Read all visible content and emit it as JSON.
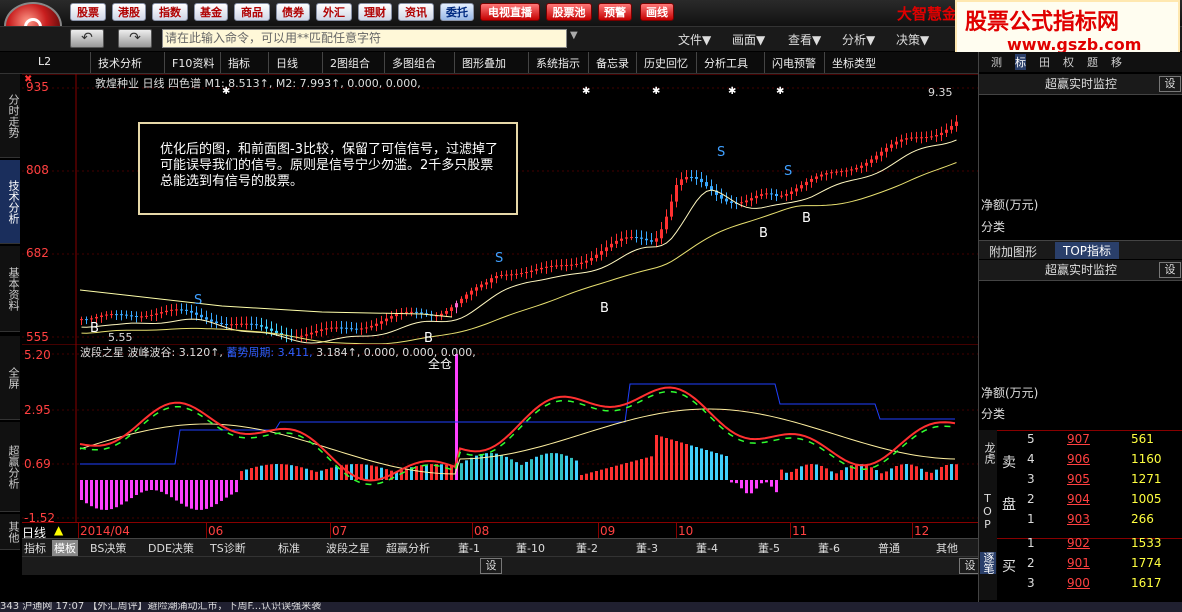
{
  "top_menu": [
    "股票",
    "港股",
    "指数",
    "基金",
    "商品",
    "债券",
    "外汇",
    "理财",
    "资讯",
    "委托",
    "电视直播",
    "股票池",
    "预警",
    "画线"
  ],
  "brand": "大智慧金融",
  "watermark": {
    "title": "股票公式指标网",
    "url": "www.gszb.com"
  },
  "command_placeholder": "请在此输入命令，可以用**匹配任意字符",
  "right_menus": [
    "文件▼",
    "画面▼",
    "查看▼",
    "分析▼",
    "决策▼"
  ],
  "toolbar": {
    "code": "L2",
    "items": [
      "技术分析",
      "F10资料",
      "指标",
      "日线",
      "2图组合",
      "多图组合",
      "图形叠加",
      "系统指示",
      "备忘录",
      "历史回忆",
      "分析工具",
      "闪电预警",
      "坐标类型"
    ]
  },
  "left_tabs": [
    "分时走势",
    "技术分析",
    "基本资料",
    "全屏",
    "超赢分析",
    "其他"
  ],
  "main_chart": {
    "header": "敦煌种业 日线  四色谱 M1: 8.513↑, M2: 7.993↑, 0.000, 0.000,",
    "yticks": [
      "935",
      "808",
      "682",
      "555"
    ],
    "top_right_label": "9.35",
    "low_label": "5.55",
    "message": "优化后的图，和前面图-3比较，保留了可信信号，过滤掉了可能误导我们的信号。原则是信号宁少勿滥。2千多只股票总能选到有信号的股票。",
    "signals": [
      "S",
      "S",
      "S",
      "S",
      "B",
      "B",
      "B",
      "B",
      "B"
    ]
  },
  "sub_chart": {
    "header": "波段之星  波峰波谷: 3.120↑,",
    "header_blue": "蓄势周期: 3.411,",
    "header_rest": "3.184↑, 0.000, 0.000, 0.000,",
    "yticks": [
      "5.20",
      "2.95",
      "0.69",
      "-1.52"
    ],
    "label": "全仓"
  },
  "date_bar": {
    "period": "日线",
    "dates": [
      "2014/04",
      "06",
      "07",
      "08",
      "09",
      "10",
      "11",
      "12"
    ]
  },
  "bottom_tabs": [
    "指标",
    "模板",
    "BS决策",
    "DDE决策",
    "TS诊断",
    "标准",
    "波段之星",
    "超赢分析",
    "董-1",
    "董-10",
    "董-2",
    "董-3",
    "董-4",
    "董-5",
    "董-6",
    "普通",
    "其他"
  ],
  "settings_label": "设",
  "status": {
    "text": "343 沪通网    17:07   【外汇周评】避险潮涌动汇市，下周F...认识误强来袭"
  },
  "right_panel": {
    "tabs": [
      "测",
      "标",
      "田",
      "权",
      "题",
      "移"
    ],
    "monitor_title": "超赢实时监控",
    "net_label": "净额(万元)",
    "class_label": "分类",
    "addon_tabs": [
      "附加图形",
      "TOP指标"
    ],
    "side_labels": [
      "龙虎",
      "TOP",
      "逐笔"
    ],
    "sell_label": "卖",
    "book_label": "盘",
    "buy_label": "买",
    "order_book": [
      {
        "lvl": "5",
        "price": "907",
        "vol": "561"
      },
      {
        "lvl": "4",
        "price": "906",
        "vol": "1160"
      },
      {
        "lvl": "3",
        "price": "905",
        "vol": "1271"
      },
      {
        "lvl": "2",
        "price": "904",
        "vol": "1005"
      },
      {
        "lvl": "1",
        "price": "903",
        "vol": "266"
      },
      {
        "lvl": "1",
        "price": "902",
        "vol": "1533"
      },
      {
        "lvl": "2",
        "price": "901",
        "vol": "1774"
      },
      {
        "lvl": "3",
        "price": "900",
        "vol": "1617"
      }
    ]
  }
}
